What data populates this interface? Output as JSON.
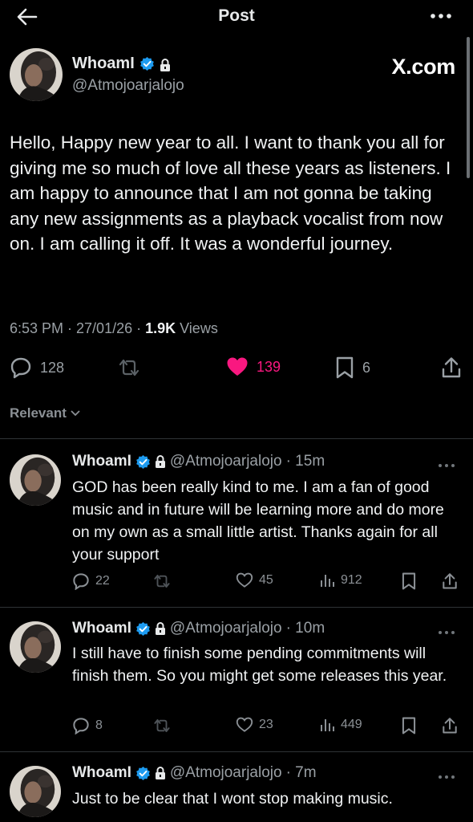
{
  "header": {
    "title": "Post",
    "back_icon": "arrow-left-icon",
    "more_icon": "more-icon"
  },
  "main_post": {
    "name": "WhoamI",
    "handle": "@Atmojoarjalojo",
    "watermark": "X.com",
    "text": "Hello, Happy new year to all. I want to thank you all for giving me so much of love all these years as listeners. I am happy to announce that I am not gonna be taking any new assignments as a playback vocalist from now on. I am calling it off. It was a wonderful journey.",
    "timestamp": "6:53 PM · 27/01/26 · ",
    "views_count": "1.9K",
    "views_label": " Views",
    "replies": "128",
    "reposts": "",
    "likes": "139",
    "bookmarks": "6",
    "like_color": "#f91880"
  },
  "sort": {
    "label": "Relevant"
  },
  "replies": [
    {
      "name": "WhoamI",
      "handle": "@Atmojoarjalojo",
      "time": "· 15m",
      "text": "GOD has been really kind to me. I am a fan of good music and in future will be learning more and do more on my own as a small little artist. Thanks again for all your support",
      "replies": "22",
      "likes": "45",
      "views": "912"
    },
    {
      "name": "WhoamI",
      "handle": "@Atmojoarjalojo",
      "time": "· 10m",
      "text": "I still have to finish some pending commitments will finish them. So you might get some releases this year.",
      "replies": "8",
      "likes": "23",
      "views": "449"
    },
    {
      "name": "WhoamI",
      "handle": "@Atmojoarjalojo",
      "time": "· 7m",
      "text": "Just to be clear that I wont stop making music."
    }
  ],
  "colors": {
    "background": "#000000",
    "verified": "#1d9bf0",
    "secondary_text": "#9aa0a5"
  }
}
